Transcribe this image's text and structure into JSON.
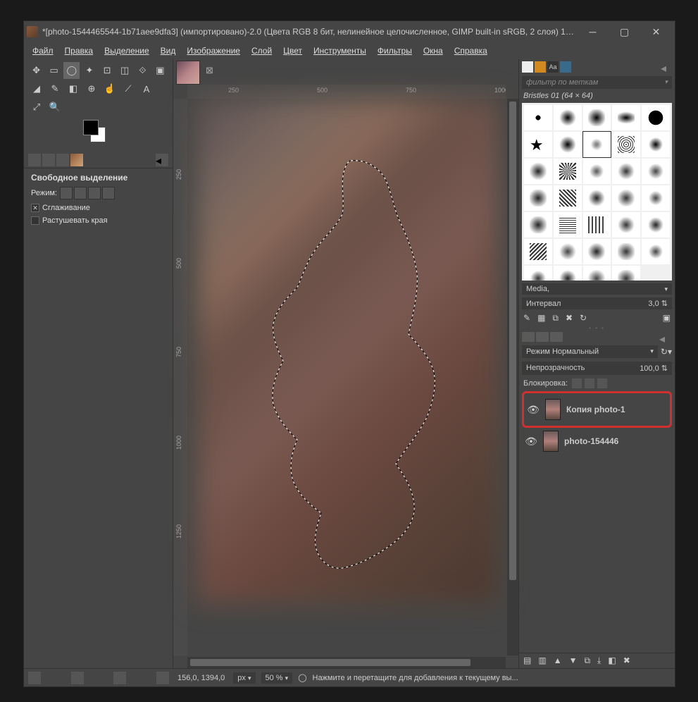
{
  "window": {
    "title": "*[photo-1544465544-1b71aee9dfa3] (импортировано)-2.0 (Цвета RGB 8 бит, нелинейное целочисленное, GIMP built-in sRGB, 2 слоя) 1000..."
  },
  "menu": {
    "file": "Файл",
    "edit": "Правка",
    "select": "Выделение",
    "view": "Вид",
    "image": "Изображение",
    "layer": "Слой",
    "colors": "Цвет",
    "tools": "Инструменты",
    "filters": "Фильтры",
    "windows": "Окна",
    "help": "Справка"
  },
  "tool_options": {
    "title": "Свободное выделение",
    "mode_label": "Режим:",
    "antialias": "Сглаживание",
    "feather": "Растушевать края"
  },
  "ruler_h": {
    "r1": "250",
    "r2": "500",
    "r3": "750",
    "r4": "1000"
  },
  "ruler_v": {
    "r1": "250",
    "r2": "500",
    "r3": "750",
    "r4": "1000",
    "r5": "1250"
  },
  "brushes": {
    "filter_placeholder": "фильтр по меткам",
    "current": "Bristles 01 (64 × 64)",
    "media_label": "Media,",
    "interval_label": "Интервал",
    "interval_value": "3,0"
  },
  "layers": {
    "mode_label": "Режим",
    "mode_value": "Нормальный",
    "opacity_label": "Непрозрачность",
    "opacity_value": "100,0",
    "lock_label": "Блокировка:",
    "items": [
      {
        "name": "Копия photo-1"
      },
      {
        "name": "photo-154446"
      }
    ]
  },
  "status": {
    "coords": "156,0, 1394,0",
    "unit": "px",
    "zoom": "50 %",
    "message": "Нажмите и перетащите для добавления к текущему вы..."
  }
}
